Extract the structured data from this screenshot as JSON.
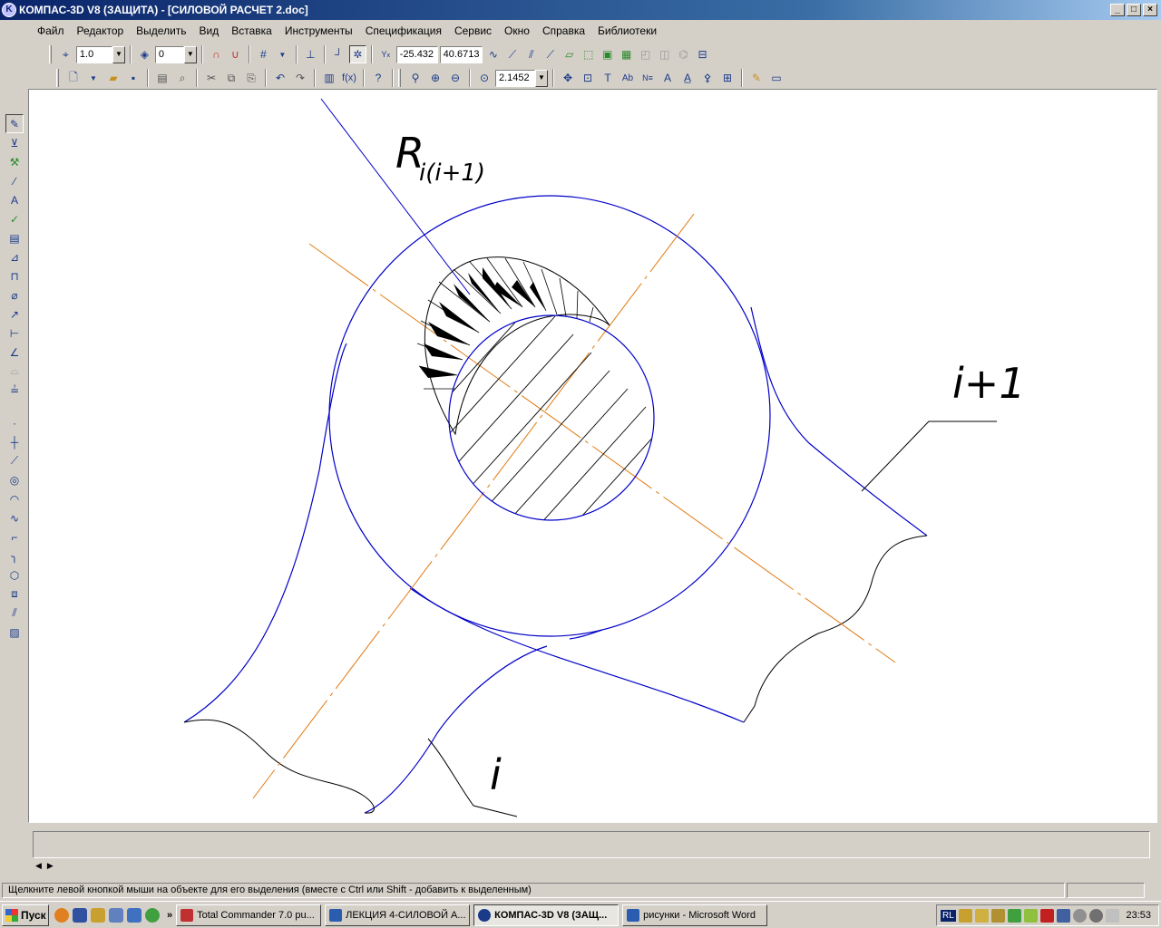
{
  "window": {
    "title": "КОМПАС-3D V8 (ЗАЩИТА) - [СИЛОВОЙ РАСЧЕТ 2.doc]",
    "controls": [
      "_",
      "□",
      "×"
    ]
  },
  "menu": [
    {
      "label": "Файл"
    },
    {
      "label": "Редактор"
    },
    {
      "label": "Выделить"
    },
    {
      "label": "Вид"
    },
    {
      "label": "Вставка"
    },
    {
      "label": "Инструменты"
    },
    {
      "label": "Спецификация"
    },
    {
      "label": "Сервис"
    },
    {
      "label": "Окно"
    },
    {
      "label": "Справка"
    },
    {
      "label": "Библиотеки"
    }
  ],
  "toolbar1": {
    "step_value": "1.0",
    "layer_value": "0",
    "coord_x": "-25.432",
    "coord_y": "40.6713"
  },
  "toolbar2": {
    "zoom_value": "2.1452"
  },
  "drawing": {
    "label_R": "R",
    "label_R_sub": "i(i+1)",
    "label_i_plus_1": "i+1",
    "label_i": "i",
    "colors": {
      "contour": "#0000c8",
      "axis": "#e07a10",
      "hatch": "#000000"
    }
  },
  "status": {
    "message": "Щелкните левой кнопкой мыши на объекте для его выделения (вместе с Ctrl или Shift - добавить к выделенным)"
  },
  "taskbar": {
    "start_label": "Пуск",
    "chevron": "»",
    "tasks": [
      {
        "label": "Total Commander 7.0 pu...",
        "active": false,
        "color": "#c03030"
      },
      {
        "label": "ЛЕКЦИЯ 4-СИЛОВОЙ А...",
        "active": false,
        "color": "#2a5db0"
      },
      {
        "label": "КОМПАС-3D V8 (ЗАЩ...",
        "active": true,
        "color": "#1a3a8a"
      },
      {
        "label": "рисунки - Microsoft Word",
        "active": false,
        "color": "#2a5db0"
      }
    ],
    "tray_lang": "RL",
    "clock": "23:53"
  }
}
